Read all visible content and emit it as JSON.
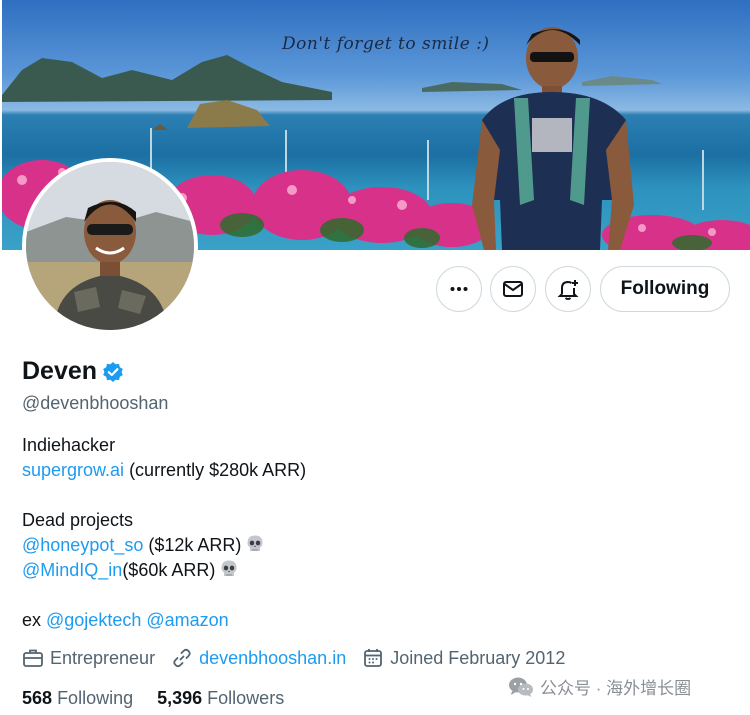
{
  "banner": {
    "caption": "Don't forget to smile :)"
  },
  "profile": {
    "display_name": "Deven",
    "handle": "@devenbhooshan",
    "verified": true
  },
  "actions": {
    "following_label": "Following"
  },
  "bio": {
    "line1": "Indiehacker",
    "line2_link": "supergrow.ai",
    "line2_text": " (currently $280k ARR)",
    "line3": "Dead projects",
    "line4_link": "@honeypot_so",
    "line4_text": " ($12k ARR)",
    "line5_link": "@MindIQ_in",
    "line5_text": "($60k ARR)",
    "line6_prefix": "ex ",
    "line6_link1": "@gojektech",
    "line6_link2": "@amazon"
  },
  "meta": {
    "profession": "Entrepreneur",
    "website": "devenbhooshan.in",
    "joined": "Joined February 2012"
  },
  "stats": {
    "following_count": "568",
    "following_label": "Following",
    "followers_count": "5,396",
    "followers_label": "Followers"
  },
  "watermark": {
    "text": "公众号 · 海外增长圈"
  },
  "colors": {
    "link": "#1d9bf0",
    "verified": "#1d9bf0",
    "secondary_text": "#536471",
    "border": "#cfd9de"
  },
  "icons": {
    "more": "more-horizontal-icon",
    "message": "envelope-icon",
    "notify": "bell-plus-icon",
    "verified": "verified-badge-icon",
    "profession": "briefcase-icon",
    "website": "link-icon",
    "joined": "calendar-icon",
    "skull": "skull-icon",
    "wechat": "wechat-icon"
  }
}
